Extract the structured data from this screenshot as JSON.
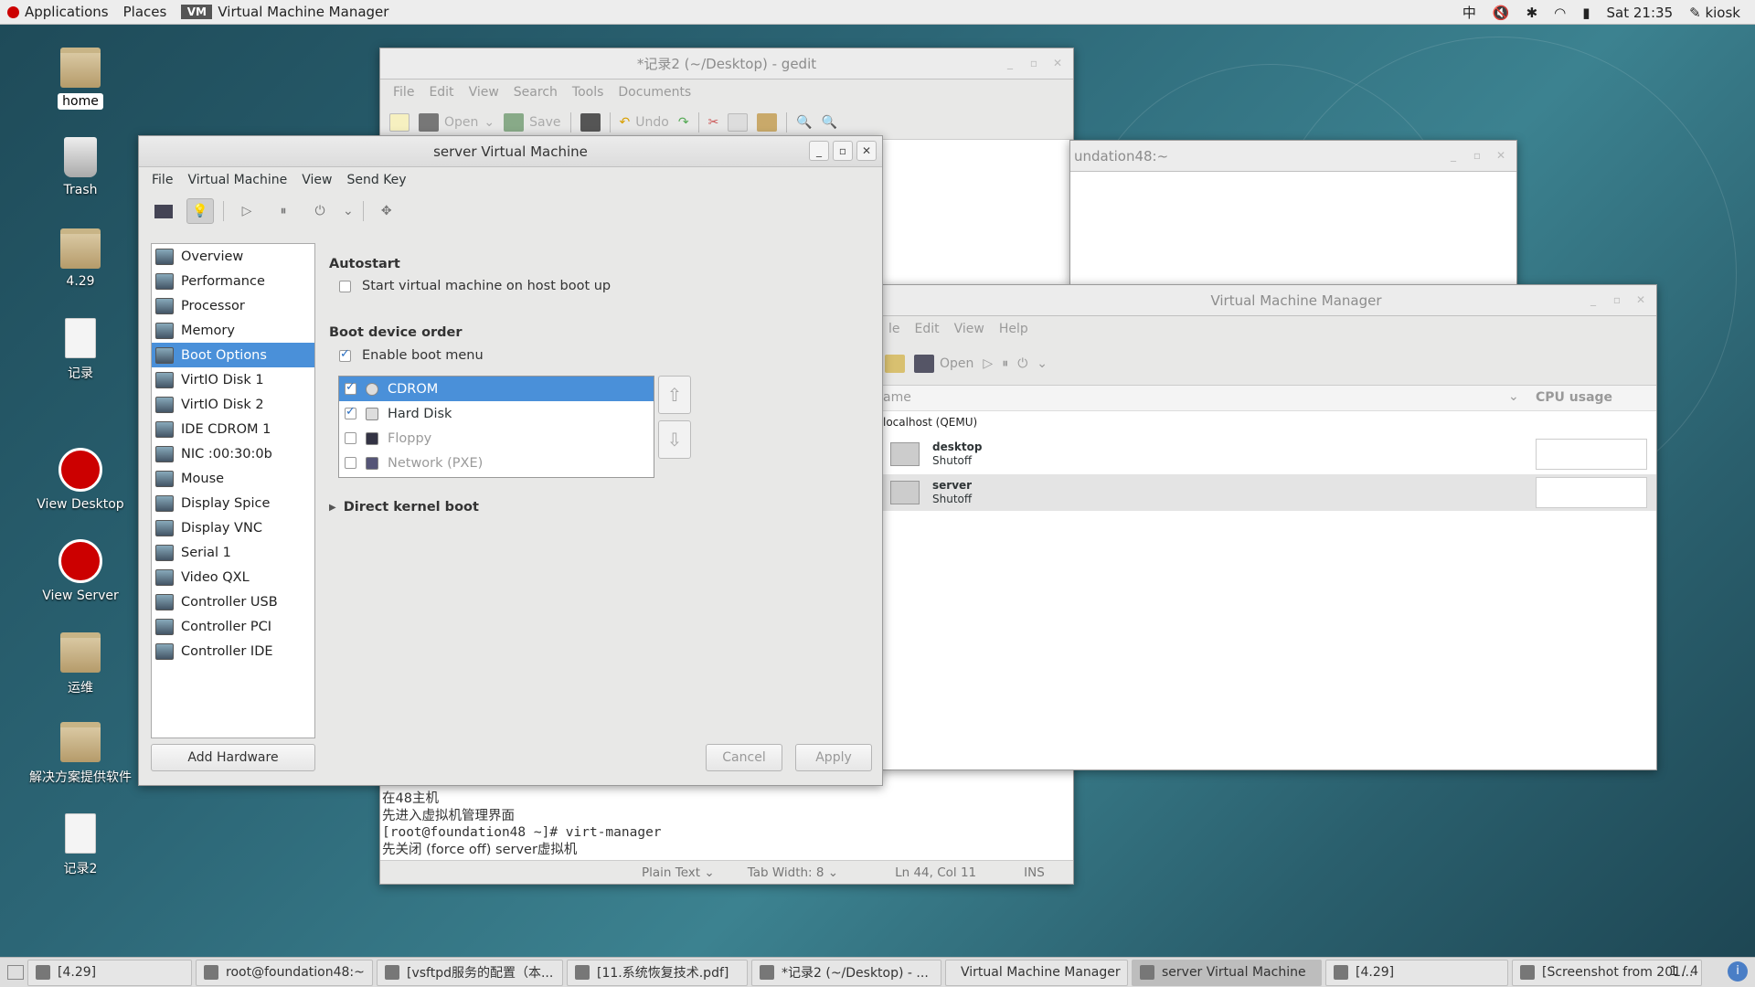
{
  "topbar": {
    "applications": "Applications",
    "places": "Places",
    "app_name": "Virtual Machine Manager",
    "input_method": "中",
    "clock": "Sat 21:35",
    "user": "kiosk"
  },
  "desktop": {
    "icons": {
      "home": "home",
      "trash": "Trash",
      "f429": "4.29",
      "jilu": "记录",
      "view_desktop": "View Desktop",
      "view_server": "View Server",
      "yunwei": "运维",
      "jiejue": "解决方案提供软件",
      "jilu2": "记录2"
    }
  },
  "gedit": {
    "title": "*记录2 (~/Desktop) - gedit",
    "menu": [
      "File",
      "Edit",
      "View",
      "Search",
      "Tools",
      "Documents"
    ],
    "toolbar": {
      "open": "Open",
      "save": "Save",
      "undo": "Undo"
    },
    "lines": [
      "在48主机",
      "先进入虚拟机管理界面",
      "[root@foundation48 ~]# virt-manager",
      "先关闭 (force off) server虚拟机"
    ],
    "status": {
      "lang": "Plain Text",
      "tab": "Tab Width:  8",
      "pos": "Ln 44, Col 11",
      "mode": "INS"
    }
  },
  "terminal": {
    "title": "undation48:~"
  },
  "vmm": {
    "title": "Virtual Machine Manager",
    "menu": [
      "le",
      "Edit",
      "View",
      "Help"
    ],
    "toolbar_open": "Open",
    "col_name": "ame",
    "col_cpu": "CPU usage",
    "host": "localhost (QEMU)",
    "vms": [
      {
        "name": "desktop",
        "state": "Shutoff"
      },
      {
        "name": "server",
        "state": "Shutoff"
      }
    ]
  },
  "vmdetail": {
    "title": "server Virtual Machine",
    "menu": [
      "File",
      "Virtual Machine",
      "View",
      "Send Key"
    ],
    "hardware": [
      "Overview",
      "Performance",
      "Processor",
      "Memory",
      "Boot Options",
      "VirtIO Disk 1",
      "VirtIO Disk 2",
      "IDE CDROM 1",
      "NIC :00:30:0b",
      "Mouse",
      "Display Spice",
      "Display VNC",
      "Serial 1",
      "Video QXL",
      "Controller USB",
      "Controller PCI",
      "Controller IDE"
    ],
    "selected_index": 4,
    "add_hardware": "Add Hardware",
    "autostart_header": "Autostart",
    "autostart_label": "Start virtual machine on host boot up",
    "boot_order_header": "Boot device order",
    "enable_boot_menu": "Enable boot menu",
    "boot_devices": [
      {
        "label": "CDROM",
        "checked": true
      },
      {
        "label": "Hard Disk",
        "checked": true
      },
      {
        "label": "Floppy",
        "checked": false
      },
      {
        "label": "Network (PXE)",
        "checked": false
      }
    ],
    "direct_kernel": "Direct kernel boot",
    "cancel": "Cancel",
    "apply": "Apply"
  },
  "taskbar": {
    "items": [
      "[4.29]",
      "root@foundation48:~",
      "[vsftpd服务的配置（本...",
      "[11.系统恢复技术.pdf]",
      "*记录2 (~/Desktop) - ...",
      "Virtual Machine Manager",
      "server Virtual Machine",
      "[4.29]",
      "[Screenshot from 201..."
    ],
    "pager": "1 / 4"
  }
}
